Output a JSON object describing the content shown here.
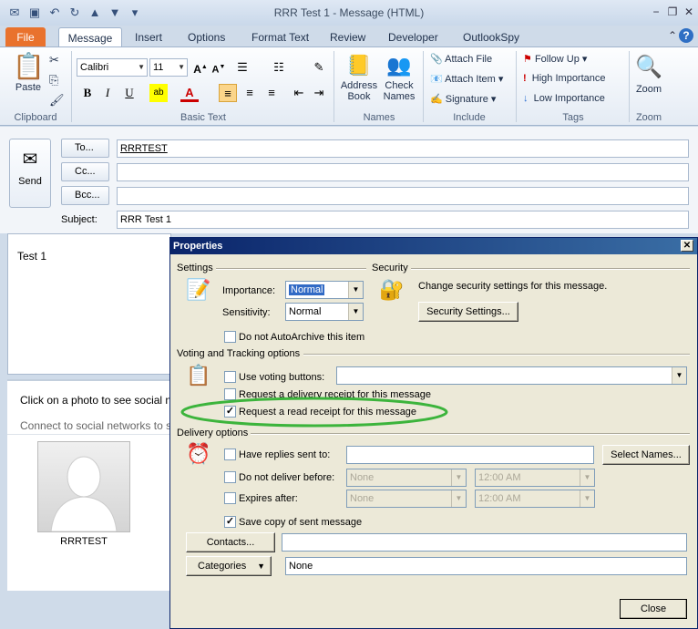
{
  "window": {
    "title": "RRR Test 1 - Message (HTML)",
    "help_icon": "?"
  },
  "tabs": [
    "File",
    "Message",
    "Insert",
    "Options",
    "Format Text",
    "Review",
    "Developer",
    "OutlookSpy"
  ],
  "ribbon": {
    "paste": "Paste",
    "font_name": "Calibri",
    "font_size": "11",
    "address_book": "Address Book",
    "check_names": "Check Names",
    "attach_file": "Attach File",
    "attach_item": "Attach Item",
    "signature": "Signature",
    "follow_up": "Follow Up",
    "high_importance": "High Importance",
    "low_importance": "Low Importance",
    "zoom": "Zoom",
    "groups": {
      "clipboard": "Clipboard",
      "basic_text": "Basic Text",
      "names": "Names",
      "include": "Include",
      "tags": "Tags",
      "zoom": "Zoom"
    }
  },
  "compose": {
    "send": "Send",
    "to_label": "To...",
    "cc_label": "Cc...",
    "bcc_label": "Bcc...",
    "subject_label": "Subject:",
    "to_value": "RRRTEST",
    "subject_value": "RRR Test 1",
    "body_text": "Test 1",
    "social_line1": "Click on a photo to see social n",
    "social_line2": "Connect to social networks to s",
    "contact_name": "RRRTEST"
  },
  "dialog": {
    "title": "Properties",
    "settings": "Settings",
    "security": "Security",
    "importance_label": "Importance:",
    "importance_value": "Normal",
    "sensitivity_label": "Sensitivity:",
    "sensitivity_value": "Normal",
    "security_text": "Change security settings for this message.",
    "security_settings_btn": "Security Settings...",
    "no_autoarchive": "Do not AutoArchive this item",
    "voting_section": "Voting and Tracking options",
    "use_voting": "Use voting buttons:",
    "delivery_receipt": "Request a delivery receipt for this message",
    "read_receipt": "Request a read receipt for this message",
    "delivery_section": "Delivery options",
    "replies_sent_to": "Have replies sent to:",
    "select_names": "Select Names...",
    "do_not_deliver": "Do not deliver before:",
    "expires_after": "Expires after:",
    "date_none": "None",
    "time_value": "12:00 AM",
    "save_copy": "Save copy of sent message",
    "contacts_btn": "Contacts...",
    "categories_btn": "Categories",
    "categories_value": "None",
    "close_btn": "Close"
  }
}
